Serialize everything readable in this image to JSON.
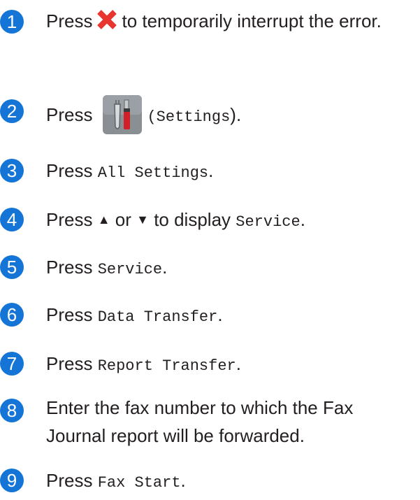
{
  "steps": [
    {
      "num": "1",
      "pre": "Press",
      "post": "to temporarily interrupt the error."
    },
    {
      "num": "2",
      "pre": "Press",
      "code": "(Settings",
      "post": ")."
    },
    {
      "num": "3",
      "pre": "Press",
      "code": "All Settings",
      "post": "."
    },
    {
      "num": "4",
      "pre": "Press",
      "up": "▲",
      "mid": "or",
      "down": "▼",
      "post": "to display",
      "code": "Service",
      "end": "."
    },
    {
      "num": "5",
      "pre": "Press",
      "code": "Service",
      "post": "."
    },
    {
      "num": "6",
      "pre": "Press",
      "code": "Data Transfer",
      "post": "."
    },
    {
      "num": "7",
      "pre": "Press",
      "code": "Report Transfer",
      "post": "."
    },
    {
      "num": "8",
      "text": "Enter the fax number to which the Fax Journal report will be forwarded."
    },
    {
      "num": "9",
      "pre": "Press",
      "code": "Fax Start",
      "post": "."
    }
  ],
  "icons": {
    "stop": "x-icon",
    "settings": "settings-icon"
  },
  "colors": {
    "step_badge": "#1475d6",
    "x_icon": "#e8352f"
  }
}
